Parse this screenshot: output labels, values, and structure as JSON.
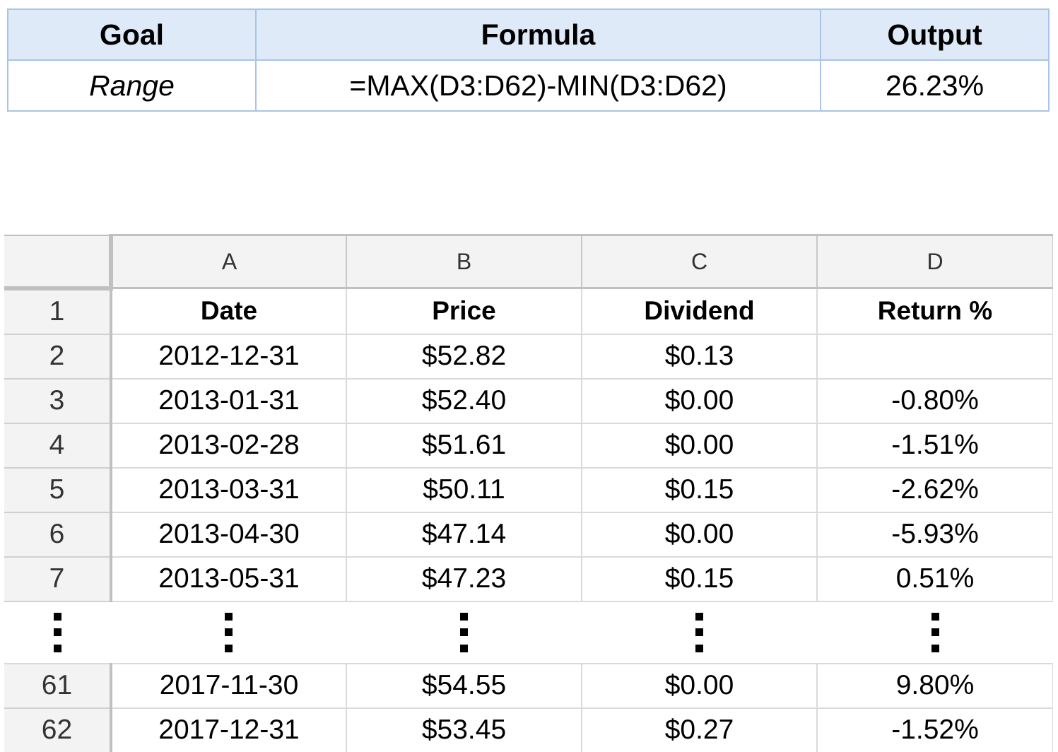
{
  "formula_table": {
    "headers": [
      "Goal",
      "Formula",
      "Output"
    ],
    "row": {
      "goal": "Range",
      "formula": "=MAX(D3:D62)-MIN(D3:D62)",
      "output": "26.23%"
    }
  },
  "sheet": {
    "columns": [
      "A",
      "B",
      "C",
      "D"
    ],
    "header_row": {
      "num": "1",
      "cells": [
        "Date",
        "Price",
        "Dividend",
        "Return %"
      ]
    },
    "rows_top": [
      {
        "num": "2",
        "cells": [
          "2012-12-31",
          "$52.82",
          "$0.13",
          ""
        ]
      },
      {
        "num": "3",
        "cells": [
          "2013-01-31",
          "$52.40",
          "$0.00",
          "-0.80%"
        ]
      },
      {
        "num": "4",
        "cells": [
          "2013-02-28",
          "$51.61",
          "$0.00",
          "-1.51%"
        ]
      },
      {
        "num": "5",
        "cells": [
          "2013-03-31",
          "$50.11",
          "$0.15",
          "-2.62%"
        ]
      },
      {
        "num": "6",
        "cells": [
          "2013-04-30",
          "$47.14",
          "$0.00",
          "-5.93%"
        ]
      },
      {
        "num": "7",
        "cells": [
          "2013-05-31",
          "$47.23",
          "$0.15",
          "0.51%"
        ]
      }
    ],
    "rows_bottom": [
      {
        "num": "61",
        "cells": [
          "2017-11-30",
          "$54.55",
          "$0.00",
          "9.80%"
        ]
      },
      {
        "num": "62",
        "cells": [
          "2017-12-31",
          "$53.45",
          "$0.27",
          "-1.52%"
        ]
      }
    ],
    "colors": {
      "header_bg": "#f3f3f3",
      "grid": "#dadada",
      "formula_header_bg": "#dfeaf8",
      "formula_border": "#a9c4e8"
    }
  }
}
